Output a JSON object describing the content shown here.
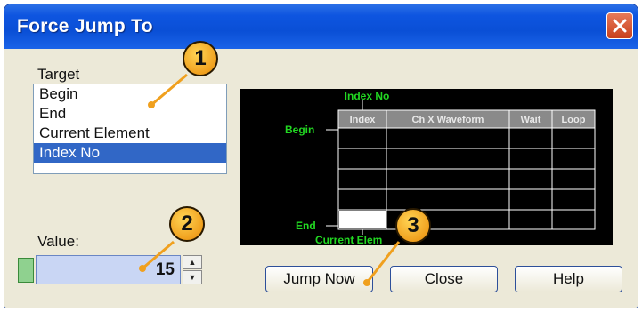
{
  "window": {
    "title": "Force Jump To"
  },
  "target": {
    "label": "Target",
    "items": [
      "Begin",
      "End",
      "Current Element",
      "Index No"
    ],
    "selected": "Index No"
  },
  "value": {
    "label": "Value:",
    "number": "15"
  },
  "diagram": {
    "index_no_label": "Index No",
    "begin_label": "Begin",
    "end_label": "End",
    "current_label": "Current Elem",
    "columns": [
      "Index",
      "Ch X Waveform",
      "Wait",
      "Loop"
    ]
  },
  "buttons": {
    "jump_now": "Jump Now",
    "close": "Close",
    "help": "Help"
  },
  "callouts": [
    "1",
    "2",
    "3"
  ],
  "colors": {
    "titlebar": "#0a4fd6",
    "selection": "#3167c6",
    "callout": "#f0a01e",
    "diagram_label": "#22d822"
  }
}
